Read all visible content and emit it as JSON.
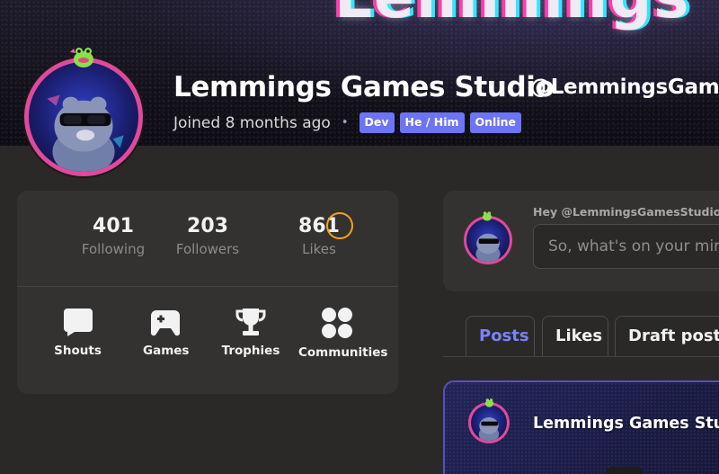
{
  "banner": {
    "glitch_text": "Lemmings"
  },
  "profile": {
    "display_name": "Lemmings Games Studio",
    "handle": "@LemmingsGames",
    "joined": "Joined 8 months ago",
    "separator": "•",
    "tags": [
      "Dev",
      "He / Him",
      "Online"
    ]
  },
  "stats": [
    {
      "value": "401",
      "label": "Following"
    },
    {
      "value": "203",
      "label": "Followers"
    },
    {
      "value": "861",
      "label": "Likes"
    }
  ],
  "nav": [
    {
      "label": "Shouts",
      "icon": "speech-bubble-icon"
    },
    {
      "label": "Games",
      "icon": "gamepad-icon"
    },
    {
      "label": "Trophies",
      "icon": "trophy-icon"
    },
    {
      "label": "Communities",
      "icon": "communities-icon"
    }
  ],
  "composer": {
    "greeting": "Hey @LemmingsGamesStudio",
    "placeholder": "So, what's on your mind"
  },
  "tabs": [
    {
      "label": "Posts",
      "active": true
    },
    {
      "label": "Likes",
      "active": false
    },
    {
      "label": "Draft posts",
      "active": false
    }
  ],
  "post": {
    "author": "Lemmings Games Studio"
  },
  "colors": {
    "accent": "#6d74f5",
    "active_tab": "#7a82ff",
    "avatar_ring": "#e0499c",
    "highlight_circle": "#f4a21b",
    "background": "#2a2928",
    "card": "#333230"
  }
}
